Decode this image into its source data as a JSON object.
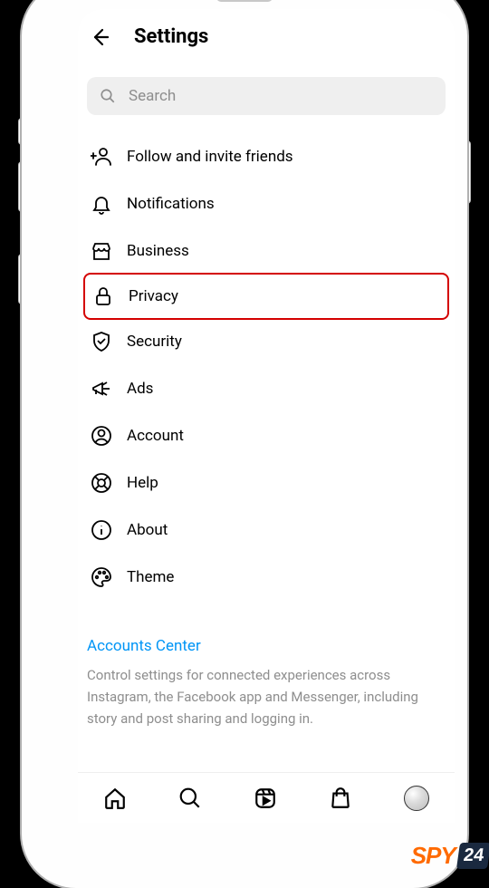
{
  "header": {
    "title": "Settings"
  },
  "search": {
    "placeholder": "Search"
  },
  "menu": [
    {
      "icon": "person-add-icon",
      "label": "Follow and invite friends",
      "highlighted": false
    },
    {
      "icon": "bell-icon",
      "label": "Notifications",
      "highlighted": false
    },
    {
      "icon": "storefront-icon",
      "label": "Business",
      "highlighted": false
    },
    {
      "icon": "lock-icon",
      "label": "Privacy",
      "highlighted": true
    },
    {
      "icon": "shield-check-icon",
      "label": "Security",
      "highlighted": false
    },
    {
      "icon": "megaphone-icon",
      "label": "Ads",
      "highlighted": false
    },
    {
      "icon": "user-circle-icon",
      "label": "Account",
      "highlighted": false
    },
    {
      "icon": "lifebuoy-icon",
      "label": "Help",
      "highlighted": false
    },
    {
      "icon": "info-icon",
      "label": "About",
      "highlighted": false
    },
    {
      "icon": "palette-icon",
      "label": "Theme",
      "highlighted": false
    }
  ],
  "accounts_center": {
    "title": "Accounts Center",
    "description": "Control settings for connected experiences across Instagram, the Facebook app and Messenger, including story and post sharing and logging in."
  },
  "bottom_nav": [
    "home-icon",
    "search-icon",
    "reels-icon",
    "shop-icon",
    "profile-avatar"
  ],
  "watermark": {
    "text1": "SPY",
    "text2": "24"
  }
}
